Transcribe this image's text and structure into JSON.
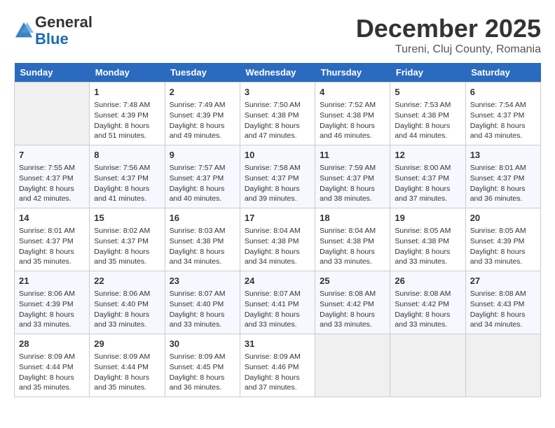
{
  "header": {
    "logo_line1": "General",
    "logo_line2": "Blue",
    "month_year": "December 2025",
    "location": "Tureni, Cluj County, Romania"
  },
  "weekdays": [
    "Sunday",
    "Monday",
    "Tuesday",
    "Wednesday",
    "Thursday",
    "Friday",
    "Saturday"
  ],
  "weeks": [
    [
      {
        "day": "",
        "empty": true
      },
      {
        "day": "1",
        "sunrise": "7:48 AM",
        "sunset": "4:39 PM",
        "daylight": "8 hours and 51 minutes."
      },
      {
        "day": "2",
        "sunrise": "7:49 AM",
        "sunset": "4:39 PM",
        "daylight": "8 hours and 49 minutes."
      },
      {
        "day": "3",
        "sunrise": "7:50 AM",
        "sunset": "4:38 PM",
        "daylight": "8 hours and 47 minutes."
      },
      {
        "day": "4",
        "sunrise": "7:52 AM",
        "sunset": "4:38 PM",
        "daylight": "8 hours and 46 minutes."
      },
      {
        "day": "5",
        "sunrise": "7:53 AM",
        "sunset": "4:38 PM",
        "daylight": "8 hours and 44 minutes."
      },
      {
        "day": "6",
        "sunrise": "7:54 AM",
        "sunset": "4:37 PM",
        "daylight": "8 hours and 43 minutes."
      }
    ],
    [
      {
        "day": "7",
        "sunrise": "7:55 AM",
        "sunset": "4:37 PM",
        "daylight": "8 hours and 42 minutes."
      },
      {
        "day": "8",
        "sunrise": "7:56 AM",
        "sunset": "4:37 PM",
        "daylight": "8 hours and 41 minutes."
      },
      {
        "day": "9",
        "sunrise": "7:57 AM",
        "sunset": "4:37 PM",
        "daylight": "8 hours and 40 minutes."
      },
      {
        "day": "10",
        "sunrise": "7:58 AM",
        "sunset": "4:37 PM",
        "daylight": "8 hours and 39 minutes."
      },
      {
        "day": "11",
        "sunrise": "7:59 AM",
        "sunset": "4:37 PM",
        "daylight": "8 hours and 38 minutes."
      },
      {
        "day": "12",
        "sunrise": "8:00 AM",
        "sunset": "4:37 PM",
        "daylight": "8 hours and 37 minutes."
      },
      {
        "day": "13",
        "sunrise": "8:01 AM",
        "sunset": "4:37 PM",
        "daylight": "8 hours and 36 minutes."
      }
    ],
    [
      {
        "day": "14",
        "sunrise": "8:01 AM",
        "sunset": "4:37 PM",
        "daylight": "8 hours and 35 minutes."
      },
      {
        "day": "15",
        "sunrise": "8:02 AM",
        "sunset": "4:37 PM",
        "daylight": "8 hours and 35 minutes."
      },
      {
        "day": "16",
        "sunrise": "8:03 AM",
        "sunset": "4:38 PM",
        "daylight": "8 hours and 34 minutes."
      },
      {
        "day": "17",
        "sunrise": "8:04 AM",
        "sunset": "4:38 PM",
        "daylight": "8 hours and 34 minutes."
      },
      {
        "day": "18",
        "sunrise": "8:04 AM",
        "sunset": "4:38 PM",
        "daylight": "8 hours and 33 minutes."
      },
      {
        "day": "19",
        "sunrise": "8:05 AM",
        "sunset": "4:38 PM",
        "daylight": "8 hours and 33 minutes."
      },
      {
        "day": "20",
        "sunrise": "8:05 AM",
        "sunset": "4:39 PM",
        "daylight": "8 hours and 33 minutes."
      }
    ],
    [
      {
        "day": "21",
        "sunrise": "8:06 AM",
        "sunset": "4:39 PM",
        "daylight": "8 hours and 33 minutes."
      },
      {
        "day": "22",
        "sunrise": "8:06 AM",
        "sunset": "4:40 PM",
        "daylight": "8 hours and 33 minutes."
      },
      {
        "day": "23",
        "sunrise": "8:07 AM",
        "sunset": "4:40 PM",
        "daylight": "8 hours and 33 minutes."
      },
      {
        "day": "24",
        "sunrise": "8:07 AM",
        "sunset": "4:41 PM",
        "daylight": "8 hours and 33 minutes."
      },
      {
        "day": "25",
        "sunrise": "8:08 AM",
        "sunset": "4:42 PM",
        "daylight": "8 hours and 33 minutes."
      },
      {
        "day": "26",
        "sunrise": "8:08 AM",
        "sunset": "4:42 PM",
        "daylight": "8 hours and 33 minutes."
      },
      {
        "day": "27",
        "sunrise": "8:08 AM",
        "sunset": "4:43 PM",
        "daylight": "8 hours and 34 minutes."
      }
    ],
    [
      {
        "day": "28",
        "sunrise": "8:09 AM",
        "sunset": "4:44 PM",
        "daylight": "8 hours and 35 minutes."
      },
      {
        "day": "29",
        "sunrise": "8:09 AM",
        "sunset": "4:44 PM",
        "daylight": "8 hours and 35 minutes."
      },
      {
        "day": "30",
        "sunrise": "8:09 AM",
        "sunset": "4:45 PM",
        "daylight": "8 hours and 36 minutes."
      },
      {
        "day": "31",
        "sunrise": "8:09 AM",
        "sunset": "4:46 PM",
        "daylight": "8 hours and 37 minutes."
      },
      {
        "day": "",
        "empty": true
      },
      {
        "day": "",
        "empty": true
      },
      {
        "day": "",
        "empty": true
      }
    ]
  ]
}
